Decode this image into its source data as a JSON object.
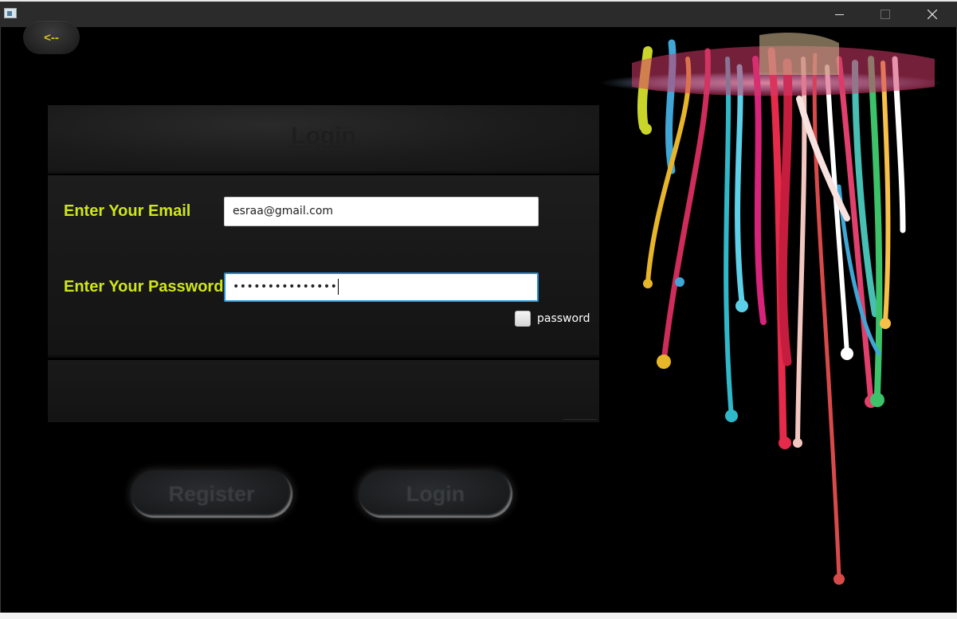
{
  "window": {
    "minimize_icon": "minimize-icon",
    "maximize_icon": "maximize-icon",
    "close_icon": "close-icon"
  },
  "back_button": {
    "label": "<--"
  },
  "login_panel": {
    "title": "Login",
    "email_label": "Enter Your Email",
    "email_value": "esraa@gmail.com",
    "password_label": "Enter Your Password",
    "password_value": "•••••••••••••••",
    "show_password_label": "password",
    "show_password_checked": false
  },
  "actions": {
    "register_label": "Register",
    "login_label": "Login"
  },
  "colors": {
    "label_color": "#cfe619",
    "back_label_color": "#d9c21a",
    "background": "#000000",
    "focus_border": "#1f8fd6"
  }
}
